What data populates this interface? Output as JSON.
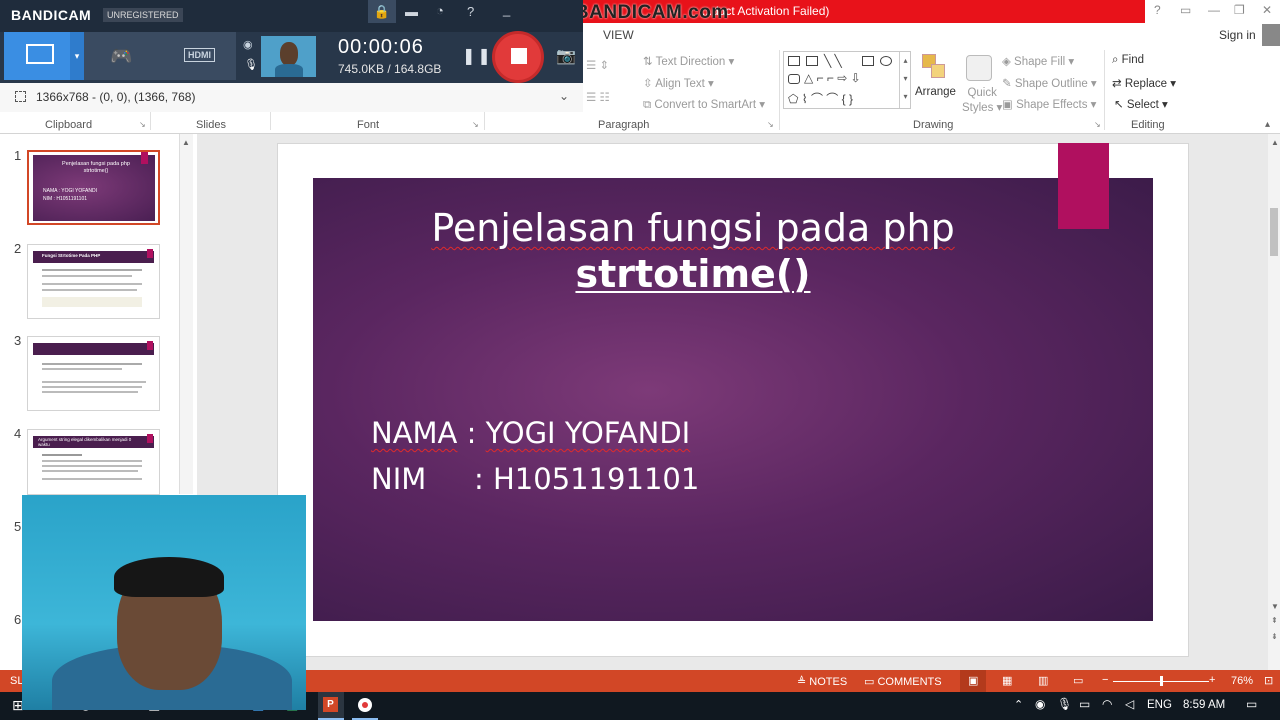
{
  "window": {
    "title_text": "...duct Activation Failed)",
    "watermark": "www.BANDICAM.com",
    "help_icon": "?",
    "sign_in": "Sign in",
    "view_tab": "VIEW"
  },
  "bandicam": {
    "logo": "BANDICAM",
    "unregistered": "UNREGISTERED",
    "timer": "00:00:06",
    "size": "745.0KB / 164.8GB",
    "region": "1366x768 - (0, 0), (1366, 768)",
    "hdmi_label": "HDMI"
  },
  "ribbon": {
    "groups": [
      "Clipboard",
      "Slides",
      "Font",
      "Paragraph",
      "Drawing",
      "Editing"
    ],
    "paragraph": {
      "text_direction": "Text Direction",
      "align_text": "Align Text",
      "convert_smartart": "Convert to SmartArt"
    },
    "drawing": {
      "arrange": "Arrange",
      "quick_styles_1": "Quick",
      "quick_styles_2": "Styles",
      "shape_fill": "Shape Fill",
      "shape_outline": "Shape Outline",
      "shape_effects": "Shape Effects"
    },
    "editing": {
      "find": "Find",
      "replace": "Replace",
      "select": "Select"
    }
  },
  "thumbnails": [
    {
      "num": "1",
      "title": "Penjelasan fungsi pada php strtotime()",
      "line1": "NAMA : YOGI YOFANDI",
      "line2": "NIM : H1051191101"
    },
    {
      "num": "2",
      "title": "Fungsi Strtotime Pada PHP"
    },
    {
      "num": "3"
    },
    {
      "num": "4",
      "title": "Argument string elegal dikembalikan menjadi 0 waktu"
    },
    {
      "num": "5"
    },
    {
      "num": "6"
    }
  ],
  "slide": {
    "title_line1": "Penjelasan fungsi pada php",
    "title_line2": "strtotime()",
    "nama_label": "NAMA",
    "nama_sep": ":",
    "nama_value": "YOGI YOFANDI",
    "nim_label": "NIM",
    "nim_sep": ":",
    "nim_value": "H1051191101"
  },
  "statusbar": {
    "slide_prefix": "SL",
    "notes": "NOTES",
    "comments": "COMMENTS",
    "zoom": "76%",
    "zoom_fraction": 0.5
  },
  "taskbar": {
    "language": "ENG",
    "time": "8:59 AM"
  },
  "colors": {
    "bandicam_blue": "#3a8ee3",
    "record_red": "#e13a3a",
    "accent_magenta": "#b0105f",
    "status_orange": "#d24726",
    "slide_purple": "#5a2660"
  }
}
